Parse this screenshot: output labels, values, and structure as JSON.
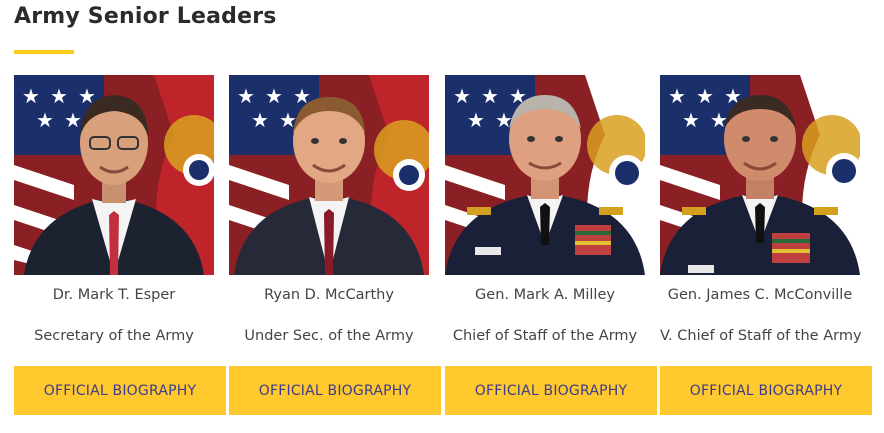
{
  "section": {
    "title": "Army Senior Leaders"
  },
  "accent_color": "#ffc82c",
  "button_text_color": "#3c3c8c",
  "leaders": [
    {
      "name": "Dr. Mark T. Esper",
      "role": "Secretary of the Army",
      "button_label": "OFFICIAL BIOGRAPHY",
      "attire": "civilian-suit",
      "tie_color": "#b02030"
    },
    {
      "name": "Ryan D. McCarthy",
      "role": "Under Sec. of the Army",
      "button_label": "OFFICIAL BIOGRAPHY",
      "attire": "civilian-suit",
      "tie_color": "#8a1a2a"
    },
    {
      "name": "Gen. Mark A. Milley",
      "role": "Chief of Staff of the Army",
      "button_label": "OFFICIAL BIOGRAPHY",
      "attire": "army-uniform",
      "tie_color": "#111111"
    },
    {
      "name": "Gen. James C. McConville",
      "role": "V. Chief of Staff of the Army",
      "button_label": "OFFICIAL BIOGRAPHY",
      "attire": "army-uniform",
      "tie_color": "#111111"
    }
  ]
}
